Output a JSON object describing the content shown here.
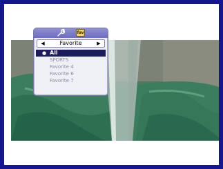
{
  "menu": {
    "icons": [
      "wrench-icon",
      "tag-icon"
    ],
    "tag_icon_text": "fav",
    "selector": {
      "label": "Favorite",
      "left_icon": "arrow-left-icon",
      "right_icon": "arrow-right-icon"
    },
    "items": [
      {
        "label": "All",
        "selected": true
      },
      {
        "label": "SPORTS",
        "selected": false
      },
      {
        "label": "Favorite 4",
        "selected": false
      },
      {
        "label": "Favorite 6",
        "selected": false
      },
      {
        "label": "Favorite 7",
        "selected": false
      }
    ]
  },
  "colors": {
    "frame": "#16168e",
    "menu_header": "#6c6cc0",
    "selected_row": "#1c1c5a",
    "item_text": "#8a8aa8"
  }
}
